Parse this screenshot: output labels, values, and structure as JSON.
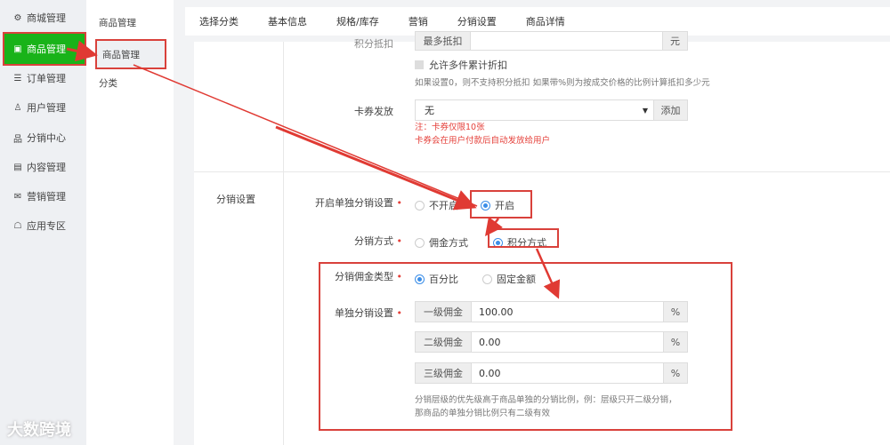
{
  "sidebar": {
    "items": [
      {
        "icon": "gear-icon",
        "glyph": "⚙",
        "label": "商城管理"
      },
      {
        "icon": "bag-icon",
        "glyph": "▣",
        "label": "商品管理"
      },
      {
        "icon": "order-icon",
        "glyph": "☰",
        "label": "订单管理"
      },
      {
        "icon": "user-icon",
        "glyph": "♙",
        "label": "用户管理"
      },
      {
        "icon": "tree-icon",
        "glyph": "品",
        "label": "分销中心"
      },
      {
        "icon": "content-icon",
        "glyph": "▤",
        "label": "内容管理"
      },
      {
        "icon": "ticket-icon",
        "glyph": "✉",
        "label": "营销管理"
      },
      {
        "icon": "app-icon",
        "glyph": "☖",
        "label": "应用专区"
      }
    ]
  },
  "submenu": {
    "title": "商品管理",
    "items": [
      "商品管理",
      "分类"
    ]
  },
  "tabs": [
    "选择分类",
    "基本信息",
    "规格/库存",
    "营销",
    "分销设置",
    "商品详情"
  ],
  "points": {
    "label": "积分抵扣",
    "prefix": "最多抵扣",
    "suffix": "元",
    "checkbox": "允许多件累计折扣",
    "hint": "如果设置0，则不支持积分抵扣 如果带%则为按成交价格的比例计算抵扣多少元"
  },
  "coupon": {
    "label": "卡券发放",
    "value": "无",
    "button": "添加",
    "note1": "注：卡券仅限10张",
    "note2": "卡券会在用户付款后自动发放给用户"
  },
  "dist": {
    "section": "分销设置",
    "enable_label": "开启单独分销设置",
    "enable_opts": [
      "不开启",
      "开启"
    ],
    "mode_label": "分销方式",
    "mode_opts": [
      "佣金方式",
      "积分方式"
    ],
    "type_label": "分销佣金类型",
    "type_opts": [
      "百分比",
      "固定金额"
    ],
    "levels_label": "单独分销设置",
    "levels": [
      {
        "name": "一级佣金",
        "value": "100.00",
        "unit": "%"
      },
      {
        "name": "二级佣金",
        "value": "0.00",
        "unit": "%"
      },
      {
        "name": "三级佣金",
        "value": "0.00",
        "unit": "%"
      }
    ],
    "hint1": "分销层级的优先级高于商品单独的分销比例，例：层级只开二级分销，",
    "hint2": "那商品的单独分销比例只有二级有效"
  },
  "watermark": "大数跨境"
}
